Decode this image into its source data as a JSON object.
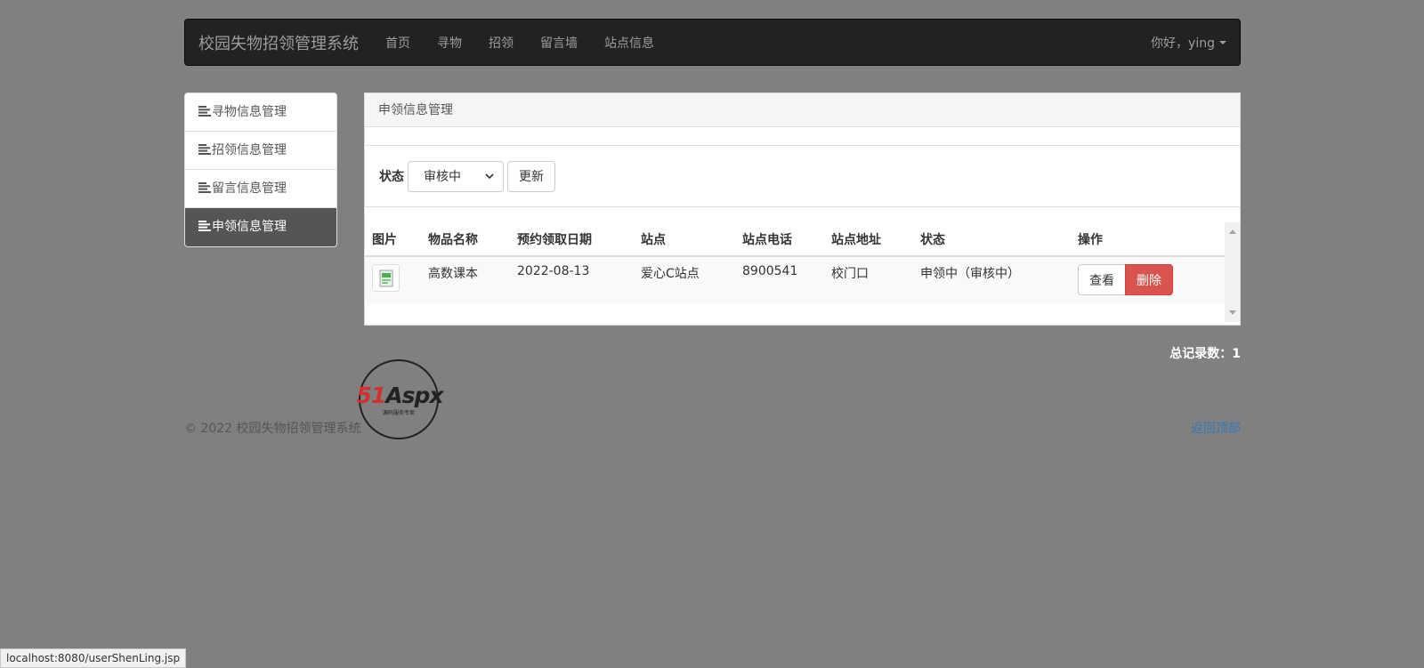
{
  "navbar": {
    "brand": "校园失物招领管理系统",
    "items": [
      "首页",
      "寻物",
      "招领",
      "留言墙",
      "站点信息"
    ],
    "user": "你好，ying"
  },
  "sidebar": {
    "items": [
      {
        "label": "寻物信息管理",
        "active": false
      },
      {
        "label": "招领信息管理",
        "active": false
      },
      {
        "label": "留言信息管理",
        "active": false
      },
      {
        "label": "申领信息管理",
        "active": true
      }
    ]
  },
  "panel": {
    "heading": "申领信息管理",
    "filter": {
      "label": "状态",
      "selected": "审核中",
      "update_button": "更新"
    }
  },
  "table": {
    "columns": [
      "图片",
      "物品名称",
      "预约领取日期",
      "站点",
      "站点电话",
      "站点地址",
      "状态",
      "操作"
    ],
    "rows": [
      {
        "item_name": "高数课本",
        "date": "2022-08-13",
        "site": "爱心C站点",
        "phone": "8900541",
        "address": "校门口",
        "status": "申领中（审核中）",
        "view_button": "查看",
        "delete_button": "删除"
      }
    ]
  },
  "total": "总记录数：1",
  "footer": {
    "copyright": "© 2022 校园失物招领管理系统",
    "back_to_top": "返回顶部"
  },
  "watermark": {
    "logo_text": "51Aspx",
    "tagline": "源码服务专家"
  },
  "status_bar_url": "localhost:8080/userShenLing.jsp",
  "colors": {
    "navbar_bg": "#222222",
    "active_sidebar_bg": "#555555",
    "danger": "#d9534f",
    "link": "#337ab7",
    "page_bg": "#808080"
  }
}
